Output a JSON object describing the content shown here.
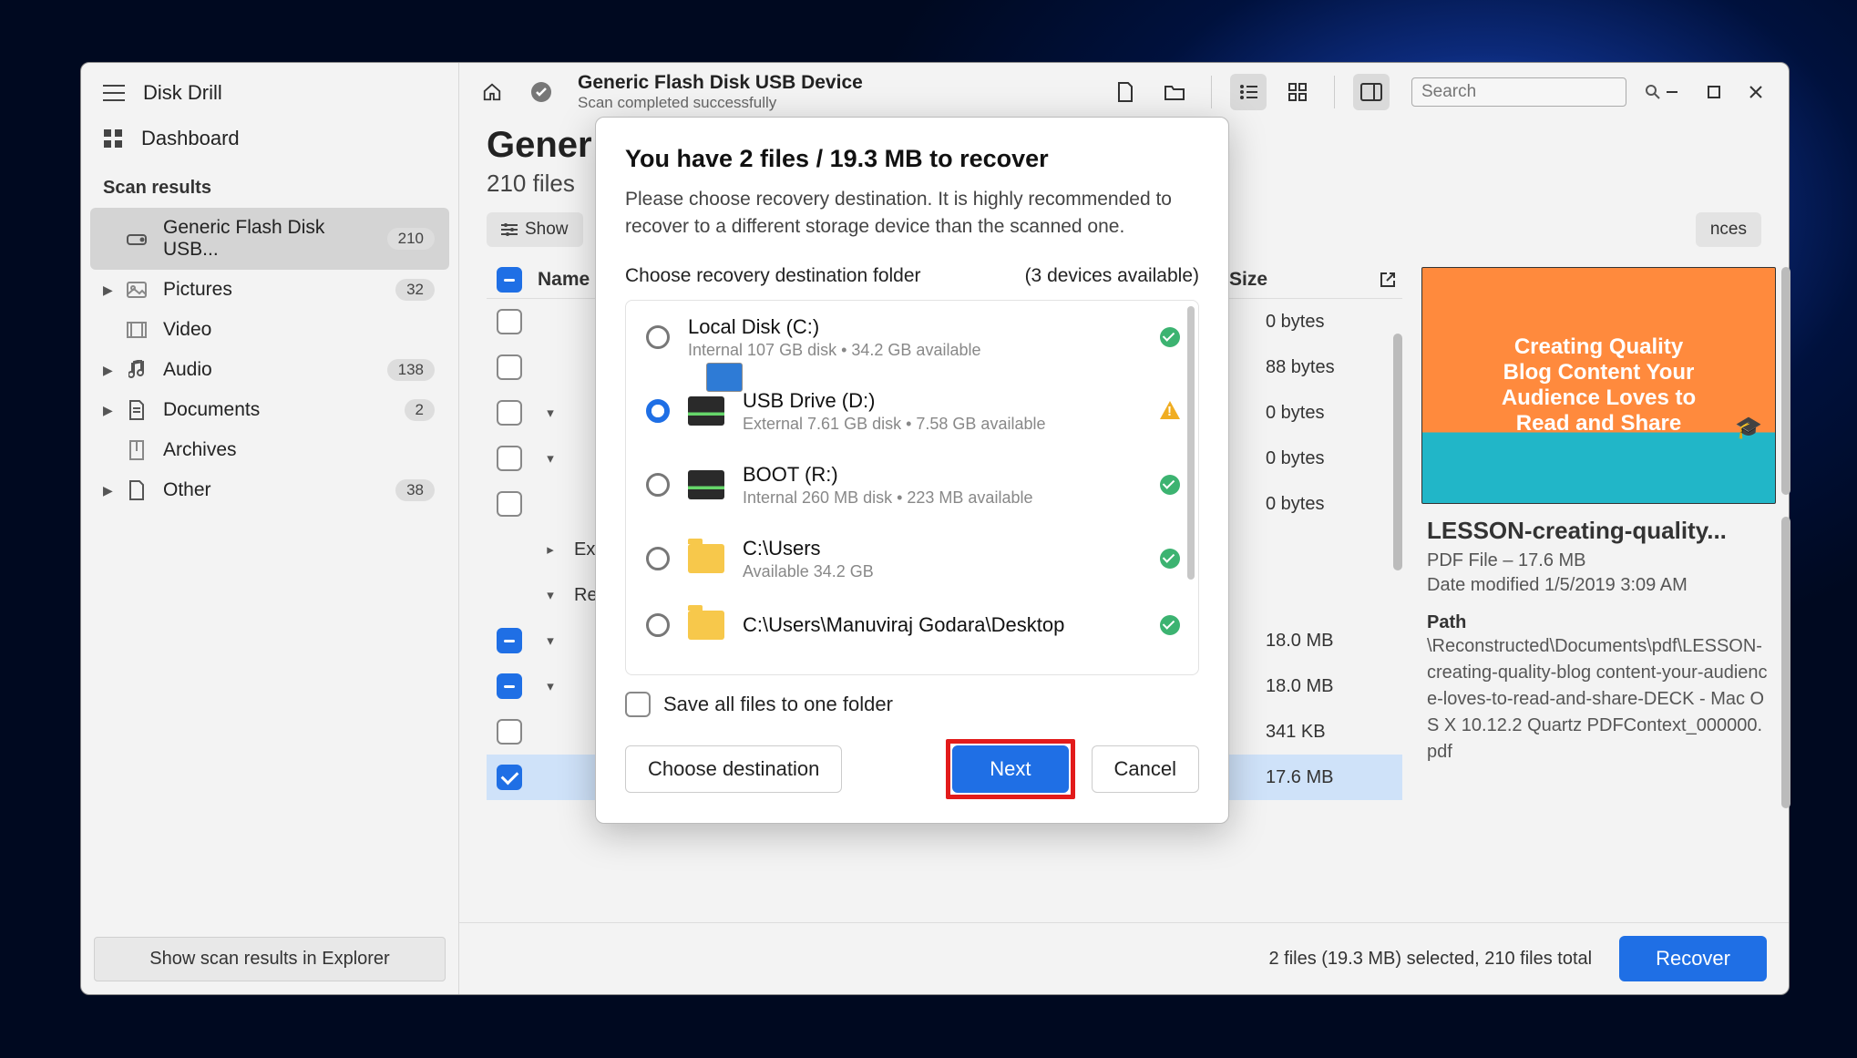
{
  "app": {
    "title": "Disk Drill"
  },
  "sidebar": {
    "dashboard": "Dashboard",
    "section": "Scan results",
    "items": [
      {
        "label": "Generic Flash Disk USB...",
        "count": "210",
        "active": true,
        "expandable": false,
        "icon": "drive"
      },
      {
        "label": "Pictures",
        "count": "32",
        "expandable": true,
        "icon": "image"
      },
      {
        "label": "Video",
        "count": "",
        "expandable": false,
        "icon": "film"
      },
      {
        "label": "Audio",
        "count": "138",
        "expandable": true,
        "icon": "note"
      },
      {
        "label": "Documents",
        "count": "2",
        "expandable": true,
        "icon": "doc"
      },
      {
        "label": "Archives",
        "count": "",
        "expandable": false,
        "icon": "arch"
      },
      {
        "label": "Other",
        "count": "38",
        "expandable": true,
        "icon": "other"
      }
    ],
    "footer_btn": "Show scan results in Explorer"
  },
  "topbar": {
    "device_title": "Generic Flash Disk USB Device",
    "device_status": "Scan completed successfully",
    "search_placeholder": "Search"
  },
  "crumb": {
    "title": "Gener",
    "sub": "210 files"
  },
  "filters": {
    "show": "Show",
    "chances": "nces"
  },
  "table": {
    "th_name": "Name",
    "th_size": "Size",
    "rows": [
      {
        "check": "none",
        "caret": "",
        "name": "",
        "size": "0 bytes"
      },
      {
        "check": "none",
        "caret": "",
        "name": "",
        "size": "88 bytes"
      },
      {
        "check": "none",
        "caret": "v",
        "name": "",
        "size": "0 bytes"
      },
      {
        "check": "none",
        "caret": "v",
        "name": "",
        "size": "0 bytes"
      },
      {
        "check": "none",
        "caret": "",
        "name": "",
        "size": "0 bytes"
      },
      {
        "check": "label",
        "caret": ">",
        "name": "Existir",
        "size": ""
      },
      {
        "check": "label",
        "caret": "v",
        "name": "Recon",
        "size": ""
      },
      {
        "check": "minus",
        "caret": "v",
        "name": "",
        "size": "18.0 MB"
      },
      {
        "check": "minus",
        "caret": "v",
        "name": "",
        "size": "18.0 MB"
      },
      {
        "check": "none",
        "caret": "",
        "name": "",
        "size": "341 KB"
      },
      {
        "check": "tick",
        "caret": "",
        "name": "",
        "size": "17.6 MB",
        "sel": true
      }
    ]
  },
  "preview": {
    "lines": [
      "Creating Quality",
      "Blog Content Your",
      "Audience Loves to",
      "Read and Share"
    ],
    "title": "LESSON-creating-quality...",
    "meta1": "PDF File – 17.6 MB",
    "meta2": "Date modified 1/5/2019 3:09 AM",
    "path_h": "Path",
    "path": "\\Reconstructed\\Documents\\pdf\\LESSON-creating-quality-blog content-your-audience-loves-to-read-and-share-DECK - Mac OS X 10.12.2 Quartz PDFContext_000000.pdf"
  },
  "footer": {
    "summary": "2 files (19.3 MB) selected, 210 files total",
    "recover": "Recover"
  },
  "modal": {
    "title": "You have 2 files / 19.3 MB to recover",
    "msg": "Please choose recovery destination. It is highly recommended to recover to a different storage device than the scanned one.",
    "sub_left": "Choose recovery destination folder",
    "sub_right": "(3 devices available)",
    "destinations": [
      {
        "name": "Local Disk (C:)",
        "sub": "Internal 107 GB disk • 34.2 GB available",
        "icon": "win",
        "status": "ok",
        "selected": false
      },
      {
        "name": "USB Drive (D:)",
        "sub": "External 7.61 GB disk • 7.58 GB available",
        "icon": "disk",
        "status": "warn",
        "selected": true
      },
      {
        "name": "BOOT (R:)",
        "sub": "Internal 260 MB disk • 223 MB available",
        "icon": "disk",
        "status": "ok",
        "selected": false
      },
      {
        "name": "C:\\Users",
        "sub": "Available 34.2 GB",
        "icon": "folder",
        "status": "ok",
        "selected": false
      },
      {
        "name": "C:\\Users\\Manuviraj Godara\\Desktop",
        "sub": "",
        "icon": "folder",
        "status": "ok",
        "selected": false
      }
    ],
    "save_all": "Save all files to one folder",
    "choose": "Choose destination",
    "next": "Next",
    "cancel": "Cancel"
  }
}
